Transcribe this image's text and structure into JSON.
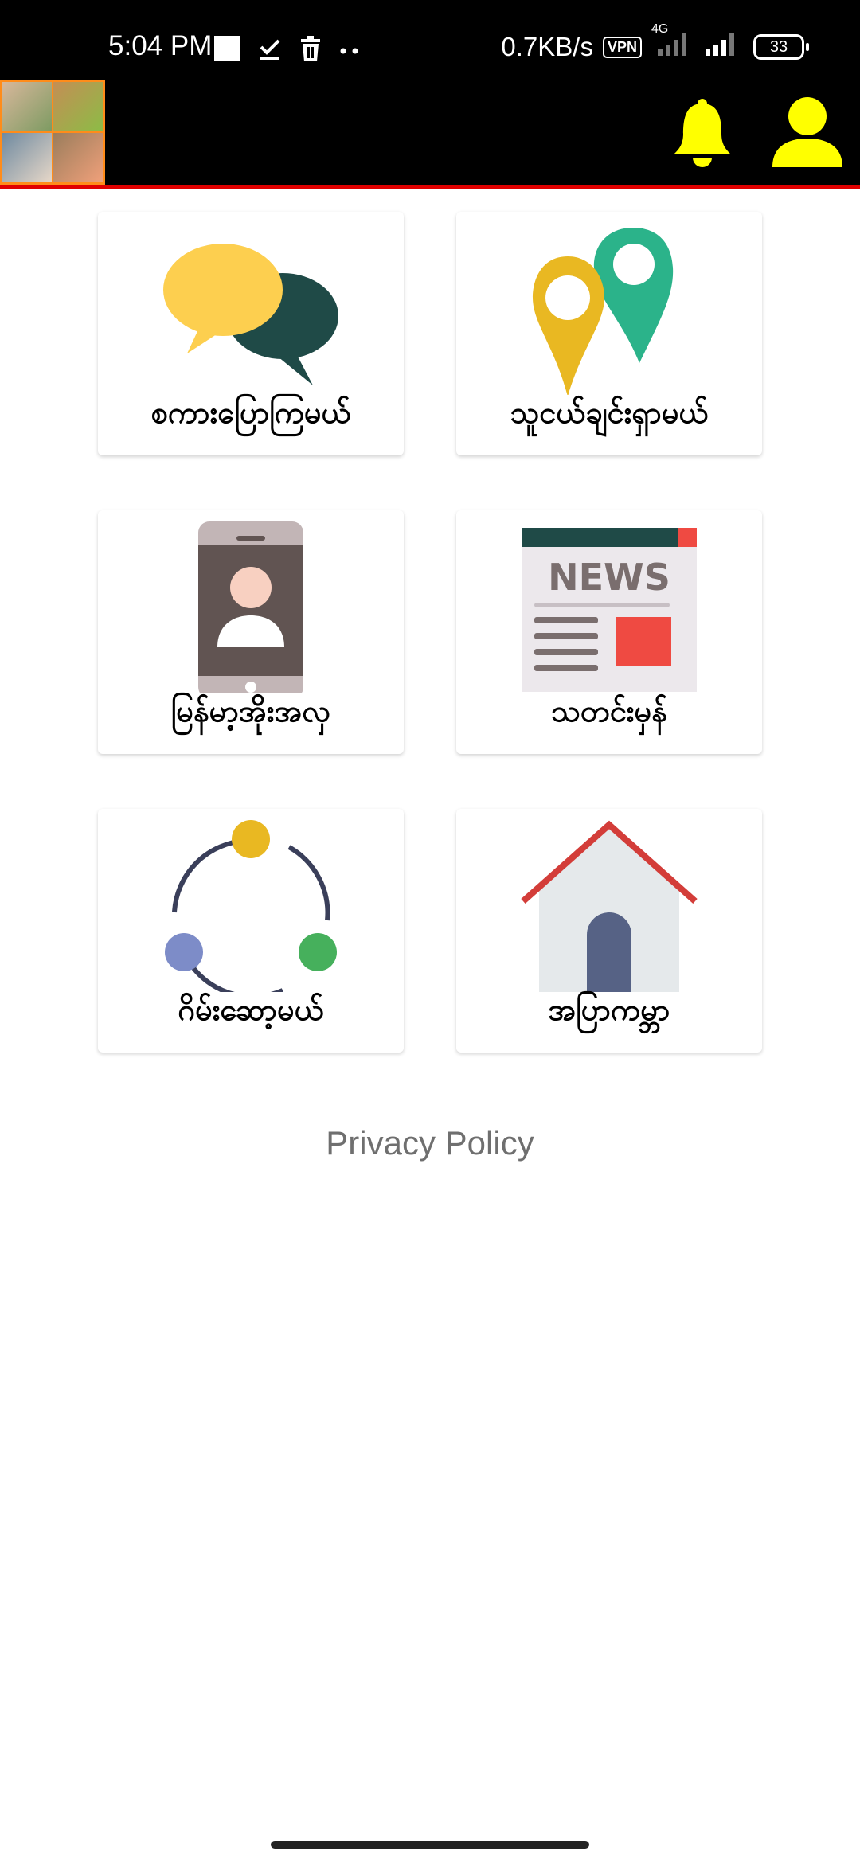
{
  "status_bar": {
    "time": "5:04 PM",
    "net_speed": "0.7KB/s",
    "vpn": "VPN",
    "network": "4G",
    "battery": "33",
    "icons": [
      "square-icon",
      "download-done-icon",
      "trash-icon",
      "more-dots-icon",
      "signal-icon",
      "battery-icon"
    ]
  },
  "app_bar": {
    "thumbnail": "profile-collage",
    "actions": [
      "bell-icon",
      "user-icon"
    ],
    "accent_color": "#ffff00",
    "underline_color": "#e00000"
  },
  "menu": [
    {
      "label": "စကားပြောကြမယ်",
      "icon": "chat-bubbles-icon"
    },
    {
      "label": "သူငယ်ချင်းရှာမယ်",
      "icon": "location-pins-icon"
    },
    {
      "label": "မြန်မာ့အိုးအလှ",
      "icon": "phone-contact-icon"
    },
    {
      "label": "သတင်းမှန်",
      "icon": "news-icon"
    },
    {
      "label": "ဂိမ်းဆော့မယ်",
      "icon": "connection-circle-icon"
    },
    {
      "label": "အပြာကမ္ဘာ",
      "icon": "house-icon"
    }
  ],
  "news_icon_text": "NEWS",
  "privacy_policy": "Privacy Policy"
}
